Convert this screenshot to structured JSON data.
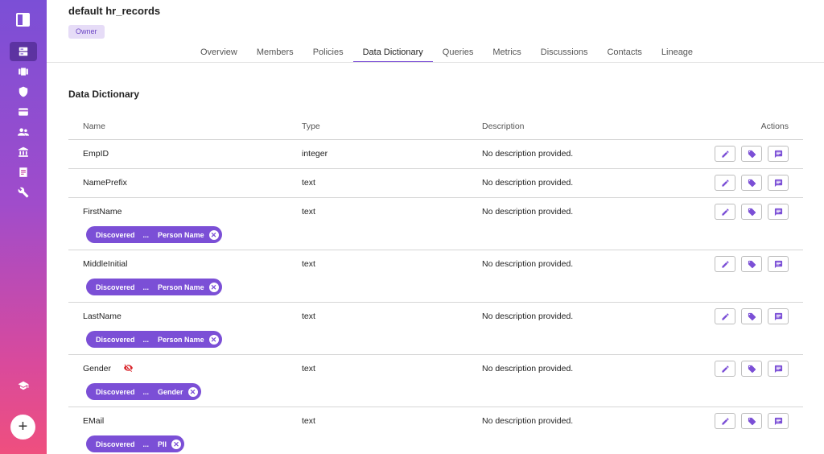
{
  "header": {
    "title": "default hr_records",
    "owner_chip": "Owner"
  },
  "tabs": [
    {
      "label": "Overview"
    },
    {
      "label": "Members"
    },
    {
      "label": "Policies"
    },
    {
      "label": "Data Dictionary"
    },
    {
      "label": "Queries"
    },
    {
      "label": "Metrics"
    },
    {
      "label": "Discussions"
    },
    {
      "label": "Contacts"
    },
    {
      "label": "Lineage"
    }
  ],
  "active_tab": "Data Dictionary",
  "section_title": "Data Dictionary",
  "table": {
    "headers": {
      "name": "Name",
      "type": "Type",
      "description": "Description",
      "actions": "Actions"
    },
    "rows": [
      {
        "name": "EmpID",
        "type": "integer",
        "description": "No description provided."
      },
      {
        "name": "NamePrefix",
        "type": "text",
        "description": "No description provided."
      },
      {
        "name": "FirstName",
        "type": "text",
        "description": "No description provided.",
        "tag": {
          "source": "Discovered",
          "sep": "...",
          "label": "Person Name"
        }
      },
      {
        "name": "MiddleInitial",
        "type": "text",
        "description": "No description provided.",
        "tag": {
          "source": "Discovered",
          "sep": "...",
          "label": "Person Name"
        }
      },
      {
        "name": "LastName",
        "type": "text",
        "description": "No description provided.",
        "tag": {
          "source": "Discovered",
          "sep": "...",
          "label": "Person Name"
        }
      },
      {
        "name": "Gender",
        "type": "text",
        "description": "No description provided.",
        "tag": {
          "source": "Discovered",
          "sep": "...",
          "label": "Gender"
        }
      },
      {
        "name": "EMail",
        "type": "text",
        "description": "No description provided.",
        "tag": {
          "source": "Discovered",
          "sep": "...",
          "label": "PII"
        }
      }
    ]
  },
  "sidebar": {
    "items": [
      {
        "icon": "catalog-icon"
      },
      {
        "icon": "projects-icon"
      },
      {
        "icon": "shield-icon"
      },
      {
        "icon": "card-icon"
      },
      {
        "icon": "people-icon"
      },
      {
        "icon": "bank-icon"
      },
      {
        "icon": "document-icon"
      },
      {
        "icon": "wrench-icon"
      },
      {
        "icon": "school-icon"
      }
    ],
    "add_label": "+"
  },
  "colors": {
    "accent": "#7b4fd6",
    "sidebar_top": "#7b4fd6",
    "sidebar_bottom": "#ef4f7e",
    "hidden_icon": "#d9262c"
  }
}
